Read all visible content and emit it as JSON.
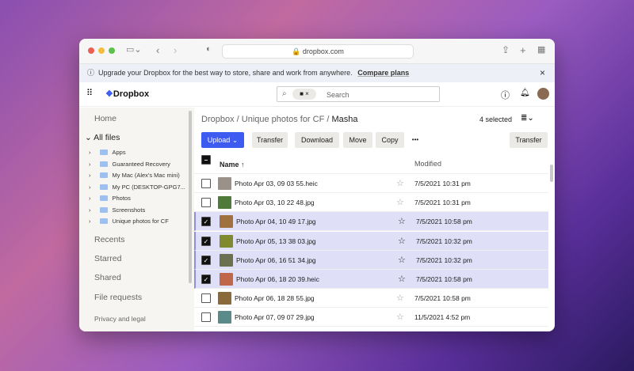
{
  "browser": {
    "url": "dropbox.com"
  },
  "banner": {
    "text": "Upgrade your Dropbox for the best way to store, share and work from anywhere.",
    "link": "Compare plans"
  },
  "header": {
    "logo": "Dropbox",
    "search_placeholder": "Search"
  },
  "sidebar": {
    "home": "Home",
    "all_files": "All files",
    "tree": [
      "Apps",
      "Guaranteed Recovery",
      "My Mac (Alex's Mac mini)",
      "My PC (DESKTOP-GPG7...",
      "Photos",
      "Screenshots",
      "Unique photos for CF"
    ],
    "recents": "Recents",
    "starred": "Starred",
    "shared": "Shared",
    "file_requests": "File requests",
    "privacy": "Privacy and legal"
  },
  "main": {
    "breadcrumb": {
      "root": "Dropbox",
      "sep1": "/",
      "folder": "Unique photos for CF",
      "sep2": "/",
      "current": "Masha"
    },
    "selected_count": "4 selected",
    "toolbar": {
      "upload": "Upload",
      "transfer": "Transfer",
      "download": "Download",
      "move": "Move",
      "copy": "Copy",
      "more": "•••",
      "transfer_right": "Transfer"
    },
    "columns": {
      "name": "Name",
      "sort": "↑",
      "modified": "Modified"
    },
    "files": [
      {
        "name": "Photo Apr 03, 09 03 55.heic",
        "modified": "7/5/2021 10:31 pm",
        "selected": false,
        "thumb": "#9a9288"
      },
      {
        "name": "Photo Apr 03, 10 22 48.jpg",
        "modified": "7/5/2021 10:31 pm",
        "selected": false,
        "thumb": "#4f7a3a"
      },
      {
        "name": "Photo Apr 04, 10 49 17.jpg",
        "modified": "7/5/2021 10:58 pm",
        "selected": true,
        "thumb": "#a0713e"
      },
      {
        "name": "Photo Apr 05, 13 38 03.jpg",
        "modified": "7/5/2021 10:32 pm",
        "selected": true,
        "thumb": "#7f8a2e"
      },
      {
        "name": "Photo Apr 06, 16 51 34.jpg",
        "modified": "7/5/2021 10:32 pm",
        "selected": true,
        "thumb": "#6b7050"
      },
      {
        "name": "Photo Apr 06, 18 20 39.heic",
        "modified": "7/5/2021 10:58 pm",
        "selected": true,
        "thumb": "#c0664a"
      },
      {
        "name": "Photo Apr 06, 18 28 55.jpg",
        "modified": "7/5/2021 10:58 pm",
        "selected": false,
        "thumb": "#8a6a3a"
      },
      {
        "name": "Photo Apr 07, 09 07 29.jpg",
        "modified": "11/5/2021 4:52 pm",
        "selected": false,
        "thumb": "#5a8a8a"
      }
    ]
  },
  "colors": {
    "accent": "#3d5af1",
    "selected_row": "#dfdff7"
  }
}
